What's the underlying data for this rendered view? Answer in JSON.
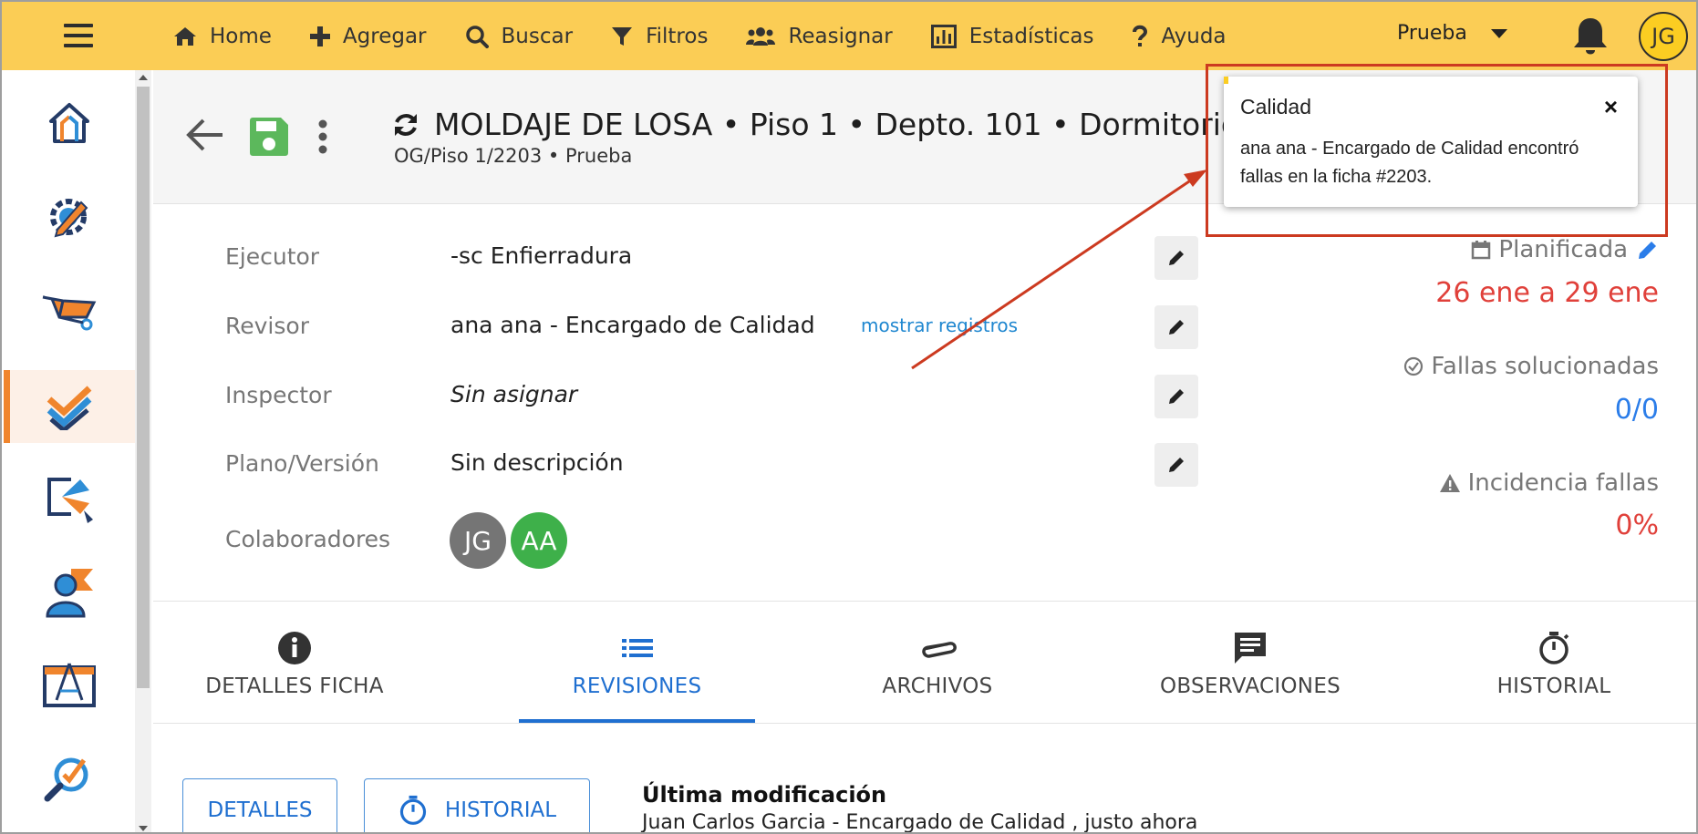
{
  "topbar": {
    "nav": [
      {
        "label": "Home",
        "icon": "home-icon"
      },
      {
        "label": "Agregar",
        "icon": "plus-icon"
      },
      {
        "label": "Buscar",
        "icon": "search-icon"
      },
      {
        "label": "Filtros",
        "icon": "filter-icon"
      },
      {
        "label": "Reasignar",
        "icon": "users-icon"
      },
      {
        "label": "Estadísticas",
        "icon": "bar-chart-icon"
      },
      {
        "label": "Ayuda",
        "icon": "question-icon"
      }
    ],
    "project": "Prueba",
    "avatar_initials": "JG"
  },
  "header": {
    "title": "MOLDAJE DE LOSA • Piso 1 • Depto. 101 • Dormitorio 1",
    "subtitle": "OG/Piso 1/2203 • Prueba"
  },
  "details": {
    "ejecutor_label": "Ejecutor",
    "ejecutor_value": "-sc Enfierradura",
    "revisor_label": "Revisor",
    "revisor_value": "ana ana - Encargado de Calidad",
    "revisor_link": "mostrar registros",
    "inspector_label": "Inspector",
    "inspector_value": "Sin asignar",
    "plano_label": "Plano/Versión",
    "plano_value": "Sin descripción",
    "colaboradores_label": "Colaboradores",
    "colaboradores": [
      {
        "initials": "JG",
        "color": "#757575"
      },
      {
        "initials": "AA",
        "color": "#3eb04a"
      }
    ]
  },
  "stats": {
    "planificada_label": "Planificada",
    "planificada_value": "26 ene a 29 ene",
    "fallas_label": "Fallas solucionadas",
    "fallas_value": "0/0",
    "incidencia_label": "Incidencia fallas",
    "incidencia_value": "0%"
  },
  "tabs": [
    {
      "label": "DETALLES FICHA",
      "icon": "info-icon"
    },
    {
      "label": "REVISIONES",
      "icon": "list-icon",
      "active": true
    },
    {
      "label": "ARCHIVOS",
      "icon": "paperclip-icon"
    },
    {
      "label": "OBSERVACIONES",
      "icon": "comment-icon"
    },
    {
      "label": "HISTORIAL",
      "icon": "stopwatch-icon"
    }
  ],
  "revisiones": {
    "detalles_button": "DETALLES",
    "historial_button": "HISTORIAL",
    "last_mod_title": "Última modificación",
    "last_mod_text": "Juan Carlos Garcia - Encargado de Calidad , justo ahora"
  },
  "notification": {
    "title": "Calidad",
    "close": "×",
    "message": "ana ana - Encargado de Calidad encontró fallas en la ficha #2203."
  },
  "colors": {
    "topbar": "#fbcd55",
    "accent_orange": "#f0852d",
    "primary_blue": "#1f6fd0",
    "red_value": "#e0403a",
    "blue_value": "#2b7de9",
    "save_green": "#5cb85c",
    "annotation_red": "#cc3a20"
  }
}
